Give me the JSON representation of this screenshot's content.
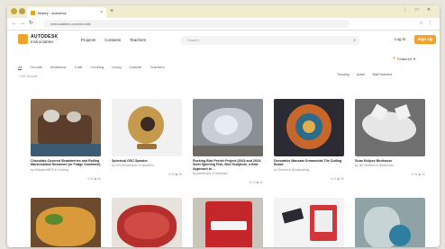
{
  "browser": {
    "tab_title": "Makey - autodesk",
    "url": "instructables.com/circuits",
    "new_tab": "+",
    "right_icons": "⋮ □ ✕",
    "address_icons": "☆ ⋮"
  },
  "header": {
    "logo_line1": "AUTODESK",
    "logo_line2": "Instructables",
    "nav": [
      "Projects",
      "Contests",
      "Teachers"
    ],
    "search_placeholder": "Search",
    "sign_in": "Log In",
    "sign_up": "Sign Up"
  },
  "sort_label": "Featured",
  "tabs": [
    "All",
    "Circuits",
    "Workshop",
    "Craft",
    "Cooking",
    "Living",
    "Outside",
    "Teachers"
  ],
  "result_count": "7,000 Results",
  "filters": [
    "Trending",
    "Active",
    "Staff Selected"
  ],
  "cards": [
    {
      "title": "Chocolate-Covered Strawberries and Rolling Marshmallow Snowmen (or Fudge Snowmen)",
      "author": "by Mollyanna9876 in Cooking",
      "stats": "♥ 52 ◉ 5K"
    },
    {
      "title": "Spherical GSC Speaker",
      "author": "by CNCWoodworker in Speakers",
      "stats": "♥ 20 ◉ 3K"
    },
    {
      "title": "Rocking Bird Feeder Project (2023 and 2024: Steel Spinning Fish, Bird Sculpture, a Bird Approach to ...",
      "author": "by jwdeBruyne in Backyard",
      "stats": "♥ 12 ◉ 2K"
    },
    {
      "title": "Decorative Mancala Ornamental Tile Cutting Board",
      "author": "by ChrisUn in Woodworking",
      "stats": "♥ 21 ◉ 4K"
    },
    {
      "title": "Solar Eclipse Birdhouse",
      "author": "by Jim Wanders in Birdhouses",
      "stats": "♥ 31 ◉ 1K"
    }
  ],
  "bottom_cards": [
    {},
    {},
    {},
    {},
    {}
  ]
}
